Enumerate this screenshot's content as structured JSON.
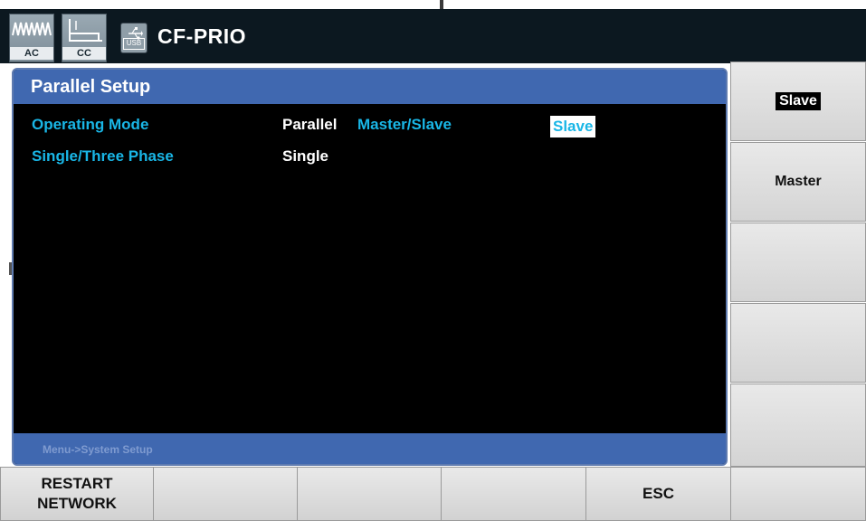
{
  "status_bar": {
    "device_name": "CF-PRIO",
    "icons": [
      {
        "name": "ac-waveform-icon",
        "label": "AC"
      },
      {
        "name": "cc-mode-icon",
        "label": "CC"
      },
      {
        "name": "usb-icon",
        "label": "USB"
      }
    ]
  },
  "panel": {
    "title": "Parallel Setup",
    "rows": [
      {
        "label": "Operating Mode",
        "value": "Parallel"
      },
      {
        "label": "Single/Three Phase",
        "value": "Single"
      }
    ],
    "master_slave": {
      "label": "Master/Slave",
      "value": "Slave"
    },
    "breadcrumb": "Menu->System Setup"
  },
  "softkeys": [
    {
      "label": "Slave",
      "selected": true
    },
    {
      "label": "Master",
      "selected": false
    },
    {
      "label": "",
      "selected": false
    },
    {
      "label": "",
      "selected": false
    },
    {
      "label": "",
      "selected": false
    }
  ],
  "function_keys": [
    {
      "label": "RESTART\nNETWORK"
    },
    {
      "label": ""
    },
    {
      "label": ""
    },
    {
      "label": ""
    },
    {
      "label": "ESC"
    },
    {
      "label": ""
    }
  ],
  "colors": {
    "header_blue": "#4068b0",
    "label_cyan": "#19b6e6",
    "screen_bg": "#000000"
  }
}
